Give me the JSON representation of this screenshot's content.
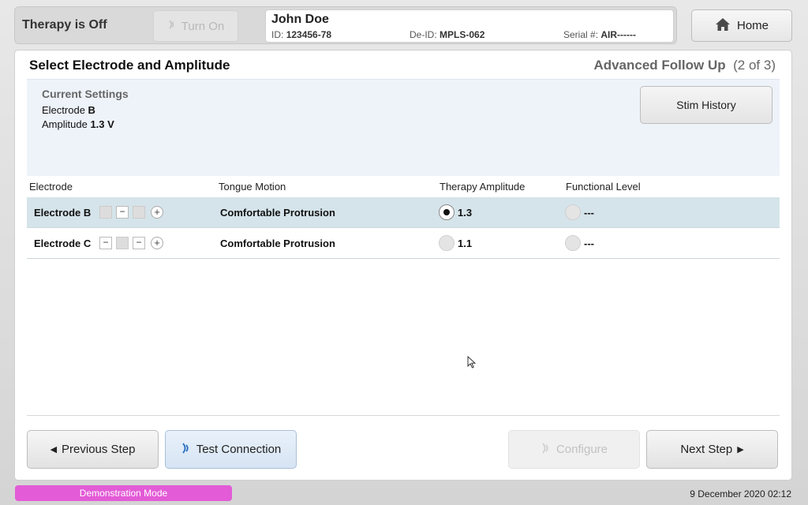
{
  "topbar": {
    "therapy_status": "Therapy is Off",
    "turn_on_label": "Turn On",
    "patient": {
      "name": "John Doe",
      "id_label": "ID:",
      "id_value": "123456-78",
      "deid_label": "De-ID:",
      "deid_value": "MPLS-062",
      "serial_label": "Serial #:",
      "serial_value": "AIR------"
    },
    "home_label": "Home"
  },
  "page": {
    "title": "Select Electrode and Amplitude",
    "step_name": "Advanced Follow Up",
    "step_current": "2",
    "step_of": "of",
    "step_total": "3"
  },
  "current_settings": {
    "heading": "Current Settings",
    "electrode_label": "Electrode",
    "electrode_value": "B",
    "amplitude_label": "Amplitude",
    "amplitude_value": "1.3 V",
    "stim_history_label": "Stim History"
  },
  "table": {
    "headers": [
      "Electrode",
      "Tongue Motion",
      "Therapy Amplitude",
      "Functional Level"
    ],
    "rows": [
      {
        "electrode": "Electrode B",
        "tongue_motion": "Comfortable Protrusion",
        "amplitude": "1.3",
        "functional_level": "---",
        "amplitude_selected": true
      },
      {
        "electrode": "Electrode C",
        "tongue_motion": "Comfortable Protrusion",
        "amplitude": "1.1",
        "functional_level": "---",
        "amplitude_selected": false
      }
    ]
  },
  "footer": {
    "previous_label": "Previous Step",
    "test_connection_label": "Test Connection",
    "configure_label": "Configure",
    "next_label": "Next Step"
  },
  "status": {
    "demo_mode": "Demonstration Mode",
    "datetime": "9 December 2020 02:12"
  },
  "colors": {
    "demo_badge": "#e35bd6",
    "selected_row": "#d5e4ea",
    "settings_panel": "#eef3fa",
    "wireless_icon": "#2a6fc0"
  }
}
